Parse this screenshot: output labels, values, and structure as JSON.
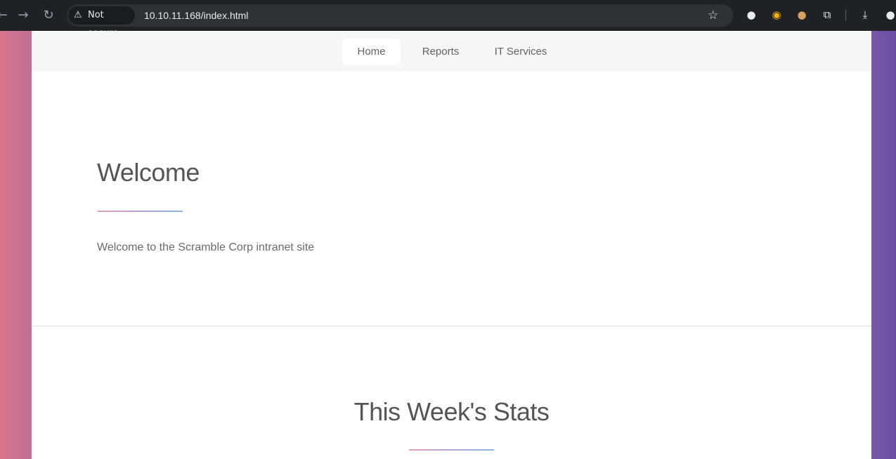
{
  "browser": {
    "security_label": "Not secure",
    "url": "10.10.11.168/index.html",
    "icons": [
      "back-icon",
      "forward-icon",
      "reload-icon",
      "warning-icon",
      "star-icon",
      "extension-icon",
      "cookie-icon",
      "puzzle-icon",
      "download-icon",
      "profile-icon"
    ]
  },
  "nav": {
    "items": [
      {
        "label": "Home",
        "active": true
      },
      {
        "label": "Reports",
        "active": false
      },
      {
        "label": "IT Services",
        "active": false
      }
    ]
  },
  "welcome": {
    "title": "Welcome",
    "text": "Welcome to the Scramble Corp intranet site"
  },
  "stats": {
    "title": "This Week's Stats"
  },
  "colors": {
    "background_left": "#d8768a",
    "background_right": "#6a4ea6",
    "rule_start": "#e6a0b8",
    "rule_end": "#89b8e6"
  }
}
